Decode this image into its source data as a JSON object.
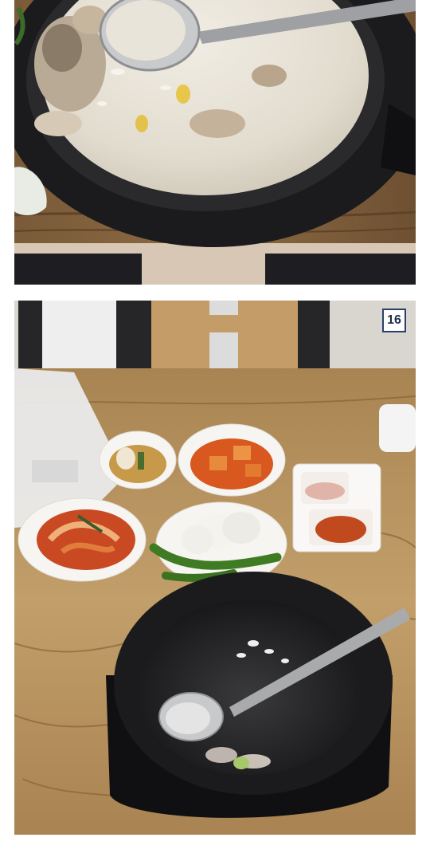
{
  "page_number_badge": "16",
  "colors": {
    "broth": "#e6e1d6",
    "pot": "#1c1c1e",
    "table_wood": "#b8935a",
    "kimchi": "#c94a22"
  }
}
